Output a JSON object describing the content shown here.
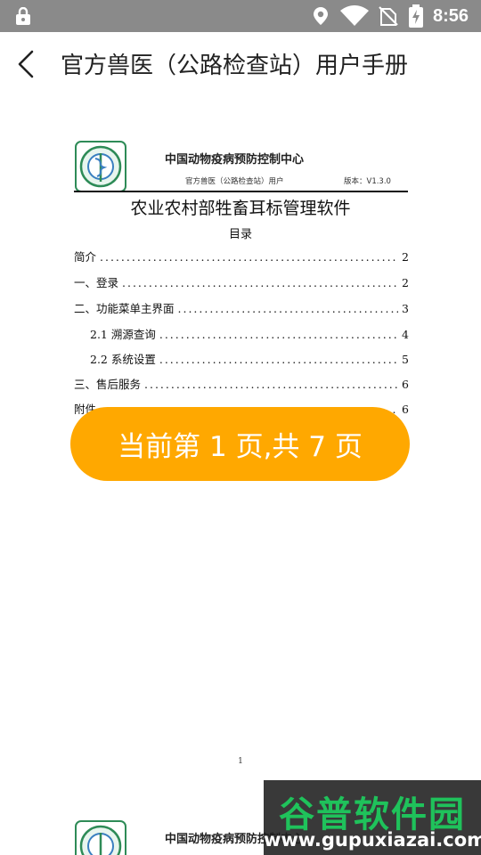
{
  "status_bar": {
    "time": "8:56",
    "icons": [
      "lock-icon",
      "location-icon",
      "wifi-icon",
      "no-sim-icon",
      "battery-charging-icon"
    ]
  },
  "app_bar": {
    "back_icon": "chevron-left-icon",
    "title": "官方兽医（公路检查站）用户手册"
  },
  "document": {
    "organization": "中国动物疫病预防控制中心",
    "subline": "官方兽医（公路检查站）用户",
    "version": "版本：V1.3.0",
    "title": "农业农村部牲畜耳标管理软件",
    "toc_heading": "目录",
    "toc": [
      {
        "label": "简介",
        "page": "2"
      },
      {
        "label": "一、登录",
        "page": "2"
      },
      {
        "label": "二、功能菜单主界面",
        "page": "3"
      },
      {
        "label": "2.1 溯源查询",
        "page": "4"
      },
      {
        "label": "2.2 系统设置",
        "page": "5"
      },
      {
        "label": "三、售后服务",
        "page": "6"
      },
      {
        "label": "附件",
        "page": "6"
      }
    ],
    "page_number": "1",
    "next_page_organization": "中国动物疫病预防控制中心"
  },
  "page_indicator": {
    "text": "当前第 1 页,共 7 页",
    "color": "#ffa800"
  },
  "watermark": {
    "title": "谷普软件园",
    "url": "www.gupuxiazai.com"
  }
}
